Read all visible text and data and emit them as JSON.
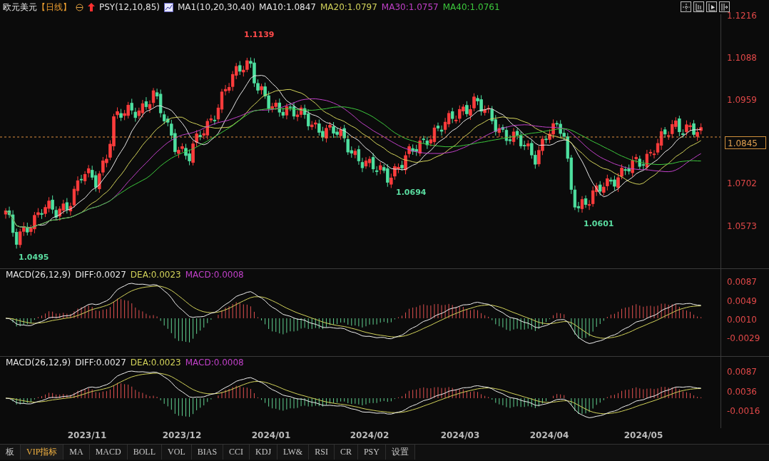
{
  "header": {
    "symbol": "欧元美元",
    "period": "【日线】",
    "indicator": "PSY(12,10,85)",
    "ma_set": "MA1(10,20,30,40)",
    "ma_values": [
      {
        "text": "MA10:1.0847",
        "color": "#e6e6e6"
      },
      {
        "text": "MA20:1.0797",
        "color": "#d2d25a"
      },
      {
        "text": "MA30:1.0757",
        "color": "#c040c8"
      },
      {
        "text": "MA40:1.0761",
        "color": "#3cc83c"
      }
    ]
  },
  "main_chart": {
    "price_axis": [
      "1.1216",
      "1.1088",
      "1.0959",
      "1.0702",
      "1.0573"
    ],
    "current_price": "1.0845",
    "annotations": [
      {
        "text": "1.1139",
        "kind": "high"
      },
      {
        "text": "1.0694",
        "kind": "low"
      },
      {
        "text": "1.0601",
        "kind": "low"
      },
      {
        "text": "1.0495",
        "kind": "low"
      }
    ]
  },
  "macd_panels": [
    {
      "title": "MACD(26,12,9)",
      "diff": "DIFF:0.0027",
      "dea": "DEA:0.0023",
      "macd": "MACD:0.0008",
      "axis": [
        "0.0087",
        "0.0049",
        "0.0010",
        "-0.0029"
      ]
    },
    {
      "title": "MACD(26,12,9)",
      "diff": "DIFF:0.0027",
      "dea": "DEA:0.0023",
      "macd": "MACD:0.0008",
      "axis": [
        "0.0087",
        "0.0036",
        "-0.0016"
      ]
    }
  ],
  "date_axis": [
    "2023/11",
    "2023/12",
    "2024/01",
    "2024/02",
    "2024/03",
    "2024/04",
    "2024/05"
  ],
  "tabs": [
    {
      "label": "板",
      "selected": false
    },
    {
      "label": "VIP指标",
      "selected": true
    },
    {
      "label": "MA",
      "selected": false
    },
    {
      "label": "MACD",
      "selected": false
    },
    {
      "label": "BOLL",
      "selected": false
    },
    {
      "label": "VOL",
      "selected": false
    },
    {
      "label": "BIAS",
      "selected": false
    },
    {
      "label": "CCI",
      "selected": false
    },
    {
      "label": "KDJ",
      "selected": false
    },
    {
      "label": "LW&",
      "selected": false
    },
    {
      "label": "RSI",
      "selected": false
    },
    {
      "label": "CR",
      "selected": false
    },
    {
      "label": "PSY",
      "selected": false
    },
    {
      "label": "设置",
      "selected": false
    }
  ]
}
